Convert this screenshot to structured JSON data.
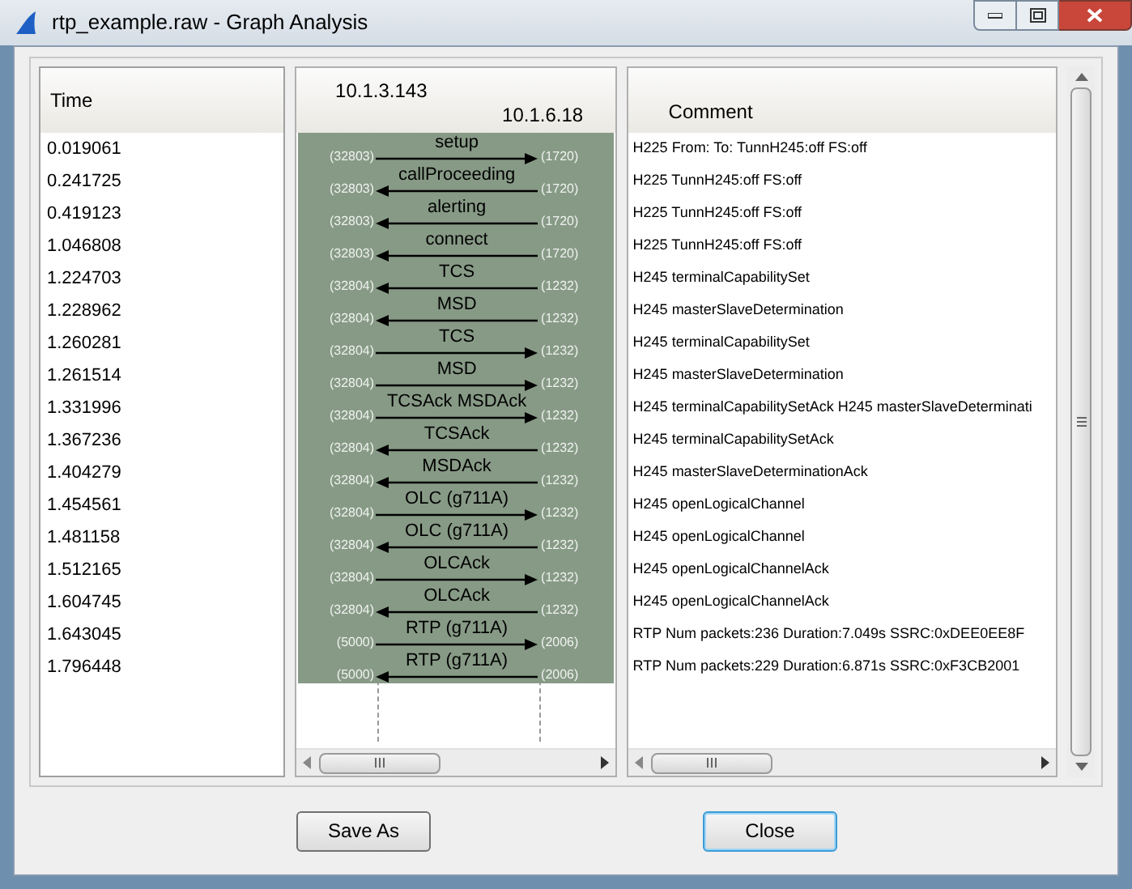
{
  "window": {
    "title": "rtp_example.raw - Graph Analysis"
  },
  "columns": {
    "time": "Time",
    "comment": "Comment"
  },
  "hosts": [
    "10.1.3.143",
    "10.1.6.18"
  ],
  "rows": [
    {
      "time": "0.019061",
      "label": "setup",
      "rightward": true,
      "left_port": "(32803)",
      "right_port": "(1720)",
      "comment": "H225 From:  To:  TunnH245:off FS:off"
    },
    {
      "time": "0.241725",
      "label": "callProceeding",
      "rightward": false,
      "left_port": "(32803)",
      "right_port": "(1720)",
      "comment": "H225 TunnH245:off FS:off"
    },
    {
      "time": "0.419123",
      "label": "alerting",
      "rightward": false,
      "left_port": "(32803)",
      "right_port": "(1720)",
      "comment": "H225 TunnH245:off FS:off"
    },
    {
      "time": "1.046808",
      "label": "connect",
      "rightward": false,
      "left_port": "(32803)",
      "right_port": "(1720)",
      "comment": "H225 TunnH245:off FS:off"
    },
    {
      "time": "1.224703",
      "label": "TCS",
      "rightward": false,
      "left_port": "(32804)",
      "right_port": "(1232)",
      "comment": "H245 terminalCapabilitySet"
    },
    {
      "time": "1.228962",
      "label": "MSD",
      "rightward": false,
      "left_port": "(32804)",
      "right_port": "(1232)",
      "comment": "H245 masterSlaveDetermination"
    },
    {
      "time": "1.260281",
      "label": "TCS",
      "rightward": true,
      "left_port": "(32804)",
      "right_port": "(1232)",
      "comment": "H245 terminalCapabilitySet"
    },
    {
      "time": "1.261514",
      "label": "MSD",
      "rightward": true,
      "left_port": "(32804)",
      "right_port": "(1232)",
      "comment": "H245 masterSlaveDetermination"
    },
    {
      "time": "1.331996",
      "label": "TCSAck MSDAck",
      "rightward": true,
      "left_port": "(32804)",
      "right_port": "(1232)",
      "comment": "H245 terminalCapabilitySetAck H245 masterSlaveDeterminati"
    },
    {
      "time": "1.367236",
      "label": "TCSAck",
      "rightward": false,
      "left_port": "(32804)",
      "right_port": "(1232)",
      "comment": "H245 terminalCapabilitySetAck"
    },
    {
      "time": "1.404279",
      "label": "MSDAck",
      "rightward": false,
      "left_port": "(32804)",
      "right_port": "(1232)",
      "comment": "H245 masterSlaveDeterminationAck"
    },
    {
      "time": "1.454561",
      "label": "OLC (g711A)",
      "rightward": true,
      "left_port": "(32804)",
      "right_port": "(1232)",
      "comment": "H245 openLogicalChannel"
    },
    {
      "time": "1.481158",
      "label": "OLC (g711A)",
      "rightward": false,
      "left_port": "(32804)",
      "right_port": "(1232)",
      "comment": "H245 openLogicalChannel"
    },
    {
      "time": "1.512165",
      "label": "OLCAck",
      "rightward": true,
      "left_port": "(32804)",
      "right_port": "(1232)",
      "comment": "H245 openLogicalChannelAck"
    },
    {
      "time": "1.604745",
      "label": "OLCAck",
      "rightward": false,
      "left_port": "(32804)",
      "right_port": "(1232)",
      "comment": "H245 openLogicalChannelAck"
    },
    {
      "time": "1.643045",
      "label": "RTP (g711A)",
      "rightward": true,
      "left_port": "(5000)",
      "right_port": "(2006)",
      "comment": "RTP Num packets:236  Duration:7.049s SSRC:0xDEE0EE8F"
    },
    {
      "time": "1.796448",
      "label": "RTP (g711A)",
      "rightward": false,
      "left_port": "(5000)",
      "right_port": "(2006)",
      "comment": "RTP Num packets:229  Duration:6.871s SSRC:0xF3CB2001"
    }
  ],
  "buttons": [
    {
      "label": "Save As",
      "focused": false
    },
    {
      "label": "Close",
      "focused": true
    }
  ]
}
